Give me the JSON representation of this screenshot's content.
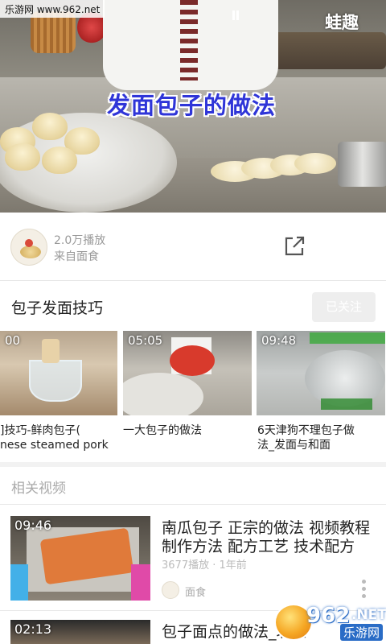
{
  "player": {
    "video_title": "发面包子的做法",
    "watermark_site": "乐游网 www.962.net",
    "brand_label": "蛙趣"
  },
  "channel": {
    "play_count": "2.0万播放",
    "source": "来自面食"
  },
  "album": {
    "title": "包子发面技巧",
    "follow_label": "已关注",
    "items": [
      {
        "duration": "00",
        "caption_line1": "]技巧-鲜肉包子(",
        "caption_line2": "nese steamed pork"
      },
      {
        "duration": "05:05",
        "caption_line1": "一大包子的做法",
        "caption_line2": ""
      },
      {
        "duration": "09:48",
        "caption_line1": "6天津狗不理包子做",
        "caption_line2": "法_发面与和面"
      }
    ]
  },
  "related": {
    "label": "相关视频",
    "items": [
      {
        "duration": "09:46",
        "title_line1": "南瓜包子 正宗的做法 视频教程",
        "title_line2": "制作方法 配方工艺 技术配方",
        "meta": "3677播放 · 1年前",
        "source": "面食"
      },
      {
        "duration": "02:13",
        "title_line1": "包子面点的做法_北京"
      }
    ]
  },
  "watermark_logo": {
    "number": "962",
    "suffix": ".NET",
    "cn": "乐游网"
  },
  "colors": {
    "title_blue": "#2f35d8",
    "follow_bg": "#eeeeee",
    "meta_gray": "#999999"
  }
}
